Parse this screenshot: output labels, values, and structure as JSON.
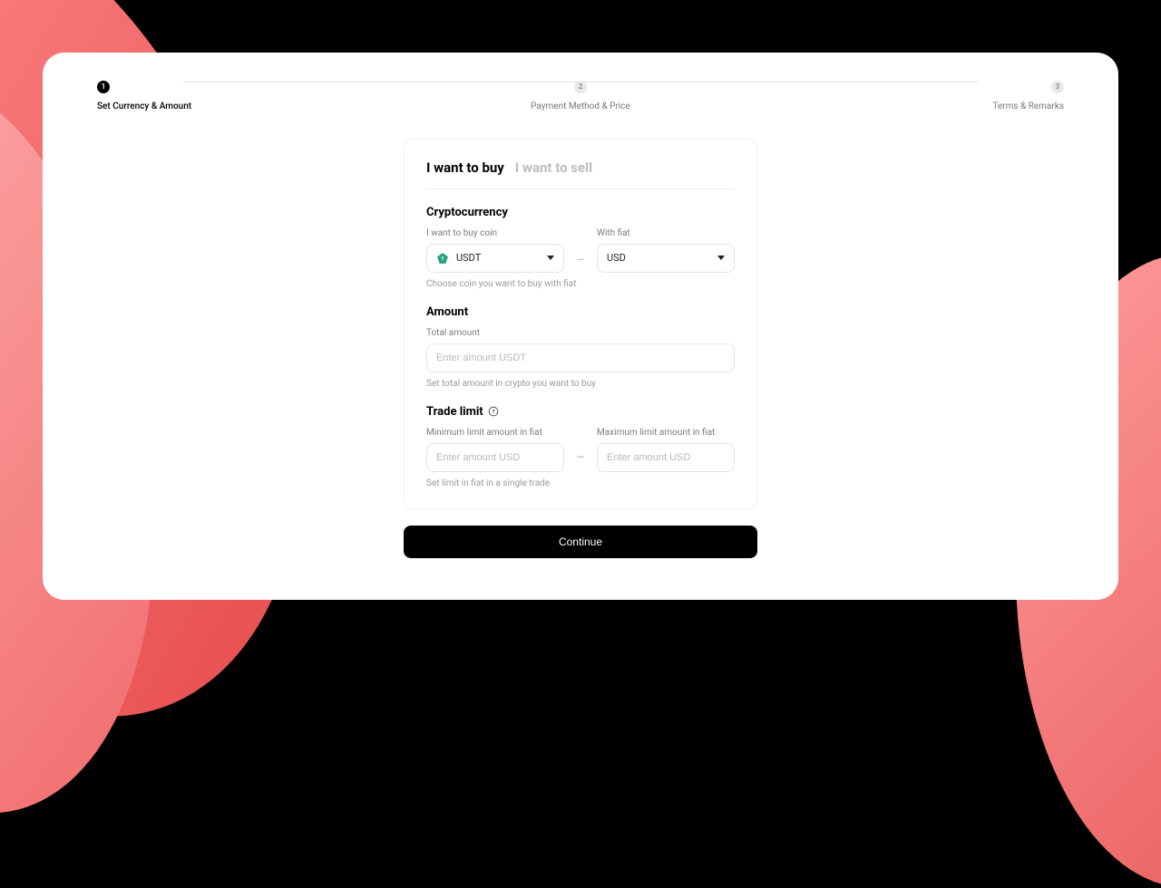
{
  "stepper": {
    "steps": [
      {
        "num": "1",
        "label": "Set Currency & Amount"
      },
      {
        "num": "2",
        "label": "Payment Method & Price"
      },
      {
        "num": "3",
        "label": "Terms & Remarks"
      }
    ]
  },
  "tabs": {
    "buy": "I want to buy",
    "sell": "I want to sell"
  },
  "crypto": {
    "title": "Cryptocurrency",
    "coin_label": "I want to buy coin",
    "coin_value": "USDT",
    "fiat_label": "With fiat",
    "fiat_value": "USD",
    "helper": "Choose coin you want to buy with fiat"
  },
  "amount": {
    "title": "Amount",
    "label": "Total amount",
    "placeholder": "Enter amount USDT",
    "helper": "Set total amount in crypto you want to buy"
  },
  "limit": {
    "title": "Trade limit",
    "min_label": "Minimum limit amount in fiat",
    "max_label": "Maximum limit amount in fiat",
    "placeholder_min": "Enter amount USD",
    "placeholder_max": "Enter amount USD",
    "helper": "Set limit in fiat in a single trade"
  },
  "cta": "Continue"
}
